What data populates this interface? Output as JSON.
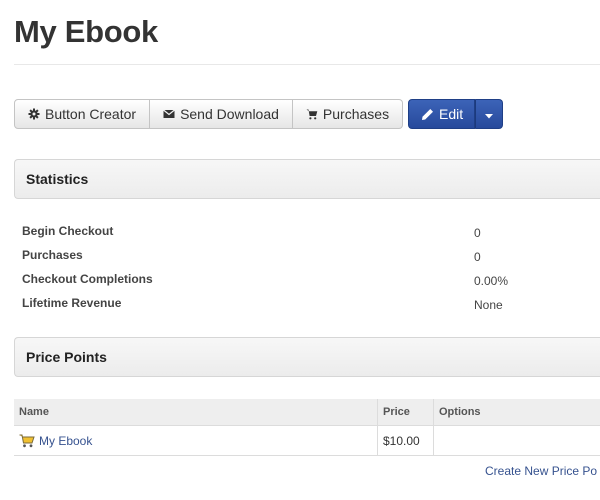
{
  "page": {
    "title": "My Ebook"
  },
  "toolbar": {
    "buttons": [
      {
        "label": "Button Creator",
        "icon": "gear-icon"
      },
      {
        "label": "Send Download",
        "icon": "envelope-icon"
      },
      {
        "label": "Purchases",
        "icon": "cart-icon"
      }
    ],
    "edit_label": "Edit",
    "edit_icon": "pencil-icon",
    "caret_icon": "caret-down-icon",
    "primary_color": "#2d52a8"
  },
  "statistics": {
    "header": "Statistics",
    "rows": [
      {
        "label": "Begin Checkout",
        "value": "0"
      },
      {
        "label": "Purchases",
        "value": "0"
      },
      {
        "label": "Checkout Completions",
        "value": "0.00%"
      },
      {
        "label": "Lifetime Revenue",
        "value": "None"
      }
    ]
  },
  "price_points": {
    "header": "Price Points",
    "columns": [
      "Name",
      "Price",
      "Options"
    ],
    "rows": [
      {
        "name": "My Ebook",
        "price": "$10.00",
        "options": "",
        "icon": "cart-icon"
      }
    ],
    "create_link": "Create New Price Po"
  },
  "colors": {
    "link": "#36528f",
    "text": "#333333"
  }
}
